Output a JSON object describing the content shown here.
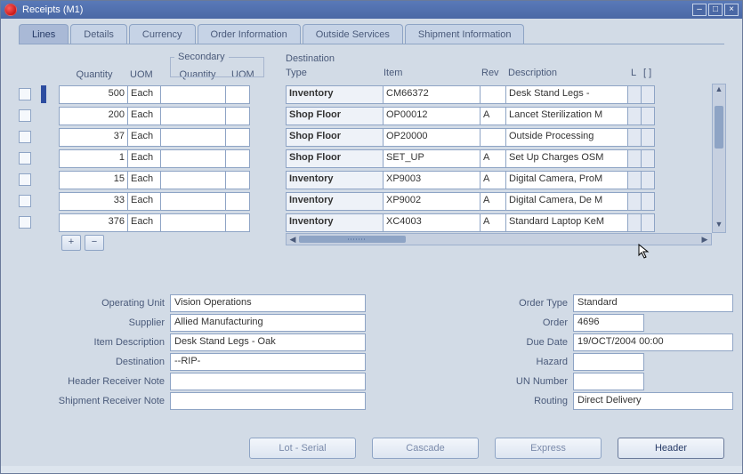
{
  "window": {
    "title": "Receipts (M1)"
  },
  "tabs": [
    {
      "label": "Lines",
      "active": true
    },
    {
      "label": "Details"
    },
    {
      "label": "Currency"
    },
    {
      "label": "Order Information"
    },
    {
      "label": "Outside Services"
    },
    {
      "label": "Shipment Information"
    }
  ],
  "left_headers": {
    "quantity": "Quantity",
    "uom": "UOM",
    "secondary_group": "Secondary",
    "secondary_quantity": "Quantity",
    "secondary_uom": "UOM"
  },
  "right_group_label": "Destination",
  "right_headers": {
    "type": "Type",
    "item": "Item",
    "rev": "Rev",
    "description": "Description",
    "l": "L",
    "brackets": "[ ]"
  },
  "rows": [
    {
      "quantity": "500",
      "uom": "Each",
      "sec_qty": "",
      "sec_uom": "",
      "type": "Inventory",
      "item": "CM66372",
      "rev": "",
      "desc": "Desk Stand Legs - "
    },
    {
      "quantity": "200",
      "uom": "Each",
      "sec_qty": "",
      "sec_uom": "",
      "type": "Shop Floor",
      "item": "OP00012",
      "rev": "A",
      "desc": "Lancet Sterilization M"
    },
    {
      "quantity": "37",
      "uom": "Each",
      "sec_qty": "",
      "sec_uom": "",
      "type": "Shop Floor",
      "item": "OP20000",
      "rev": "",
      "desc": "Outside Processing"
    },
    {
      "quantity": "1",
      "uom": "Each",
      "sec_qty": "",
      "sec_uom": "",
      "type": "Shop Floor",
      "item": "SET_UP",
      "rev": "A",
      "desc": "Set Up Charges OSM"
    },
    {
      "quantity": "15",
      "uom": "Each",
      "sec_qty": "",
      "sec_uom": "",
      "type": "Inventory",
      "item": "XP9003",
      "rev": "A",
      "desc": "Digital Camera, ProM"
    },
    {
      "quantity": "33",
      "uom": "Each",
      "sec_qty": "",
      "sec_uom": "",
      "type": "Inventory",
      "item": "XP9002",
      "rev": "A",
      "desc": "Digital Camera, De M"
    },
    {
      "quantity": "376",
      "uom": "Each",
      "sec_qty": "",
      "sec_uom": "",
      "type": "Inventory",
      "item": "XC4003",
      "rev": "A",
      "desc": "Standard Laptop KeM"
    }
  ],
  "form": {
    "operating_unit_label": "Operating Unit",
    "operating_unit": "Vision Operations",
    "supplier_label": "Supplier",
    "supplier": "Allied Manufacturing",
    "item_description_label": "Item Description",
    "item_description": "Desk Stand Legs - Oak",
    "destination_label": "Destination",
    "destination": "--RIP-",
    "header_receiver_note_label": "Header Receiver Note",
    "header_receiver_note": "",
    "shipment_receiver_note_label": "Shipment Receiver Note",
    "shipment_receiver_note": "",
    "order_type_label": "Order Type",
    "order_type": "Standard",
    "order_label": "Order",
    "order": "4696",
    "due_date_label": "Due Date",
    "due_date": "19/OCT/2004 00:00",
    "hazard_label": "Hazard",
    "hazard": "",
    "un_number_label": "UN Number",
    "un_number": "",
    "routing_label": "Routing",
    "routing": "Direct Delivery"
  },
  "buttons": {
    "lot_serial": "Lot - Serial",
    "cascade": "Cascade",
    "express": "Express",
    "header": "Header"
  },
  "icons": {
    "plus": "+",
    "minus": "−"
  }
}
